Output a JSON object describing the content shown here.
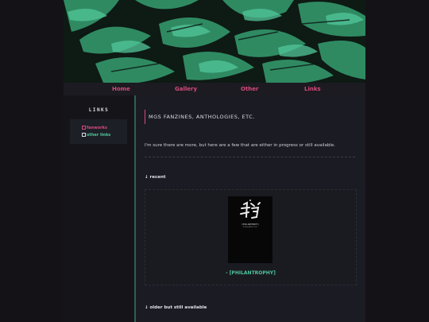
{
  "nav": {
    "items": [
      {
        "label": "Home"
      },
      {
        "label": "Gallery"
      },
      {
        "label": "Other"
      },
      {
        "label": "Links"
      }
    ]
  },
  "sidebar": {
    "title": "LINKS",
    "links": [
      {
        "label": "fanworks",
        "color": "#d64a7b"
      },
      {
        "label": "other links",
        "color": "#4fc49a"
      }
    ]
  },
  "content": {
    "title": "MGS FANZINES, ANTHOLOGIES, ETC.",
    "intro": "I'm sure there are more, but here are a few that are either in progress or still available.",
    "recent_heading": "↓ recent",
    "recent_item": {
      "caption": "- [PHILANTROPHY]",
      "cover_title": "[PHILANTHROPY]",
      "cover_subtitle": "A MGS ANTHOLOGY"
    },
    "older_heading": "↓ older but still available"
  },
  "colors": {
    "accent_pink": "#d64a7b",
    "accent_green": "#4fc49a",
    "leaf": "#2f8a62"
  }
}
